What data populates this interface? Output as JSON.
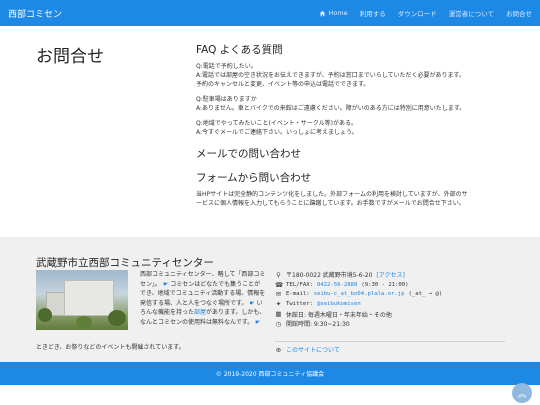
{
  "header": {
    "brand": "西部コミセン",
    "nav": [
      {
        "label": "Home",
        "icon": "home-icon"
      },
      {
        "label": "利用する"
      },
      {
        "label": "ダウンロード"
      },
      {
        "label": "運営者について"
      },
      {
        "label": "お問合せ"
      }
    ]
  },
  "main": {
    "page_title": "お問合せ",
    "faq_title": "FAQ よくある質問",
    "faq": [
      {
        "lines": [
          "Q:電話で予約したい。",
          "A:電話では部屋の空き状況をお伝えできますが、予約は窓口までいらしていただく必要があります。",
          "予約のキャンセルと変更、イベント等の申込は電話でできます。"
        ]
      },
      {
        "lines": [
          "Q:駐車場はありますか",
          "A:ありません。車とバイクでの来館はご遠慮ください。障がいのある方には特別に用意いたします。"
        ]
      },
      {
        "lines": [
          "Q:地域でやってみたいこと(イベント・サークル等)がある。",
          "A:今すぐメールでご連絡下さい。いっしょに考えましょう。"
        ]
      }
    ],
    "mail_title": "メールでの問い合わせ",
    "form_title": "フォームから問い合わせ",
    "form_lines": [
      "当HPサイトは完全静的コンテンツ化をしました。外部フォームの利用を検討していますが、外部のサ",
      "ービスに個人情報を入力してもらうことに躊躇しています。お手数ですがメールでお問合せ下さい。"
    ]
  },
  "footer": {
    "org_name": "武蔵野市立西部コミュニティセンター",
    "desc": {
      "p1": "西部コミュニティセンター、略して「西部コミセン」。",
      "p2": "コミセンはどなたでも集うことができ、地域でコミュニティ活動する場、情報を発信する場、人と人をつなぐ場所です。",
      "p3": "いろんな機能を持った",
      "room_link": "部屋",
      "p4": "があります。しかも、なんとコミセンの使用料は無料なんです。",
      "tail": "ときどき、お祭りなどのイベントも開催されています。"
    },
    "info": {
      "address": "〒180-0022 武蔵野市境5-6-20",
      "access": "[アクセス]",
      "tel_label": "TEL/FAX:",
      "tel": "0422-56-2888",
      "tel_hours": "(9:30 - 21:00)",
      "email_label": "E-mail:",
      "email": "seibu-c_at_bo04.plala.or.jp",
      "email_note": "(_at_ → @)",
      "twitter_label": "Twitter:",
      "twitter": "@seibukomisen",
      "holiday": "休館日: 毎週木曜日・年末年始・その他",
      "hours": "開館時間: 9:30~21:30"
    },
    "about": "このサイトについて"
  },
  "bottom": {
    "copyright": "© 2019-2020 西部コミュニティ協議会"
  },
  "colors": {
    "accent": "#1e88e5",
    "footer_bg": "#f0f0f0"
  }
}
